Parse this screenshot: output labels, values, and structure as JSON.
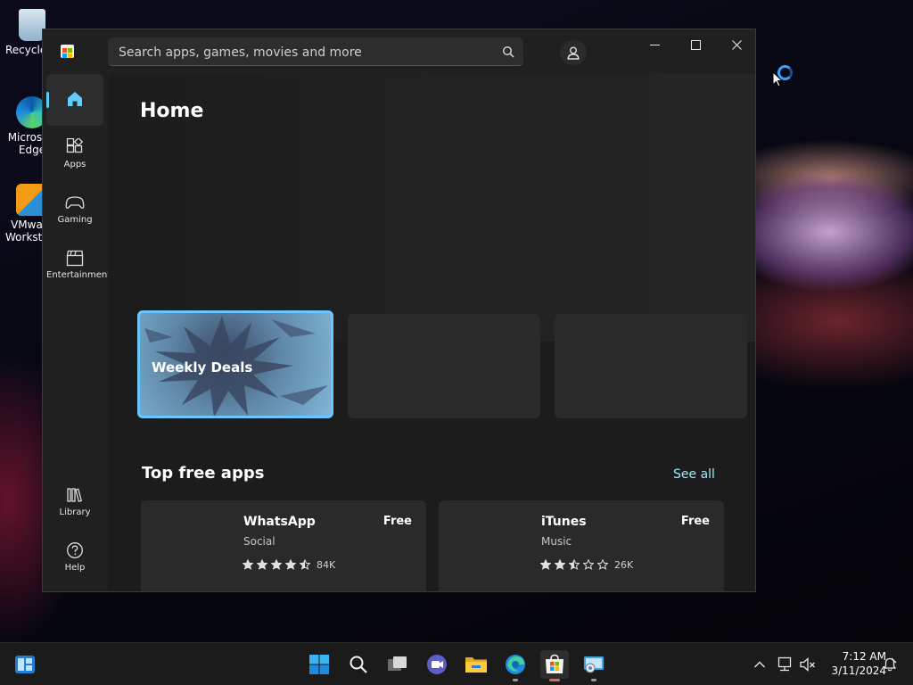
{
  "desktop": {
    "icons": [
      {
        "label": "Recycle Bin",
        "icon": "recycle-bin-icon"
      },
      {
        "label": "Microsoft Edge",
        "icon": "edge-icon"
      },
      {
        "label": "VMware Workstation",
        "icon": "vmware-icon"
      }
    ]
  },
  "window": {
    "search": {
      "placeholder": "Search apps, games, movies and more"
    },
    "sidebar": {
      "items": [
        {
          "label": "",
          "icon": "home-icon"
        },
        {
          "label": "Apps",
          "icon": "apps-icon"
        },
        {
          "label": "Gaming",
          "icon": "gamepad-icon"
        },
        {
          "label": "Entertainment",
          "icon": "clapperboard-icon"
        },
        {
          "label": "Library",
          "icon": "library-icon"
        },
        {
          "label": "Help",
          "icon": "help-icon"
        }
      ]
    },
    "main": {
      "title": "Home",
      "tiles": [
        {
          "label": "Weekly Deals"
        }
      ],
      "section": {
        "title": "Top free apps",
        "see_all": "See all"
      },
      "apps": [
        {
          "name": "WhatsApp",
          "category": "Social",
          "price": "Free",
          "rating": 4.5,
          "rating_count": "84K"
        },
        {
          "name": "iTunes",
          "category": "Music",
          "price": "Free",
          "rating": 2.5,
          "rating_count": "26K"
        }
      ]
    }
  },
  "taskbar": {
    "time": "7:12 AM",
    "date": "3/11/2024"
  },
  "colors": {
    "accent": "#60cdff",
    "link": "#99ebff",
    "focus_border": "#6ac6ff"
  }
}
